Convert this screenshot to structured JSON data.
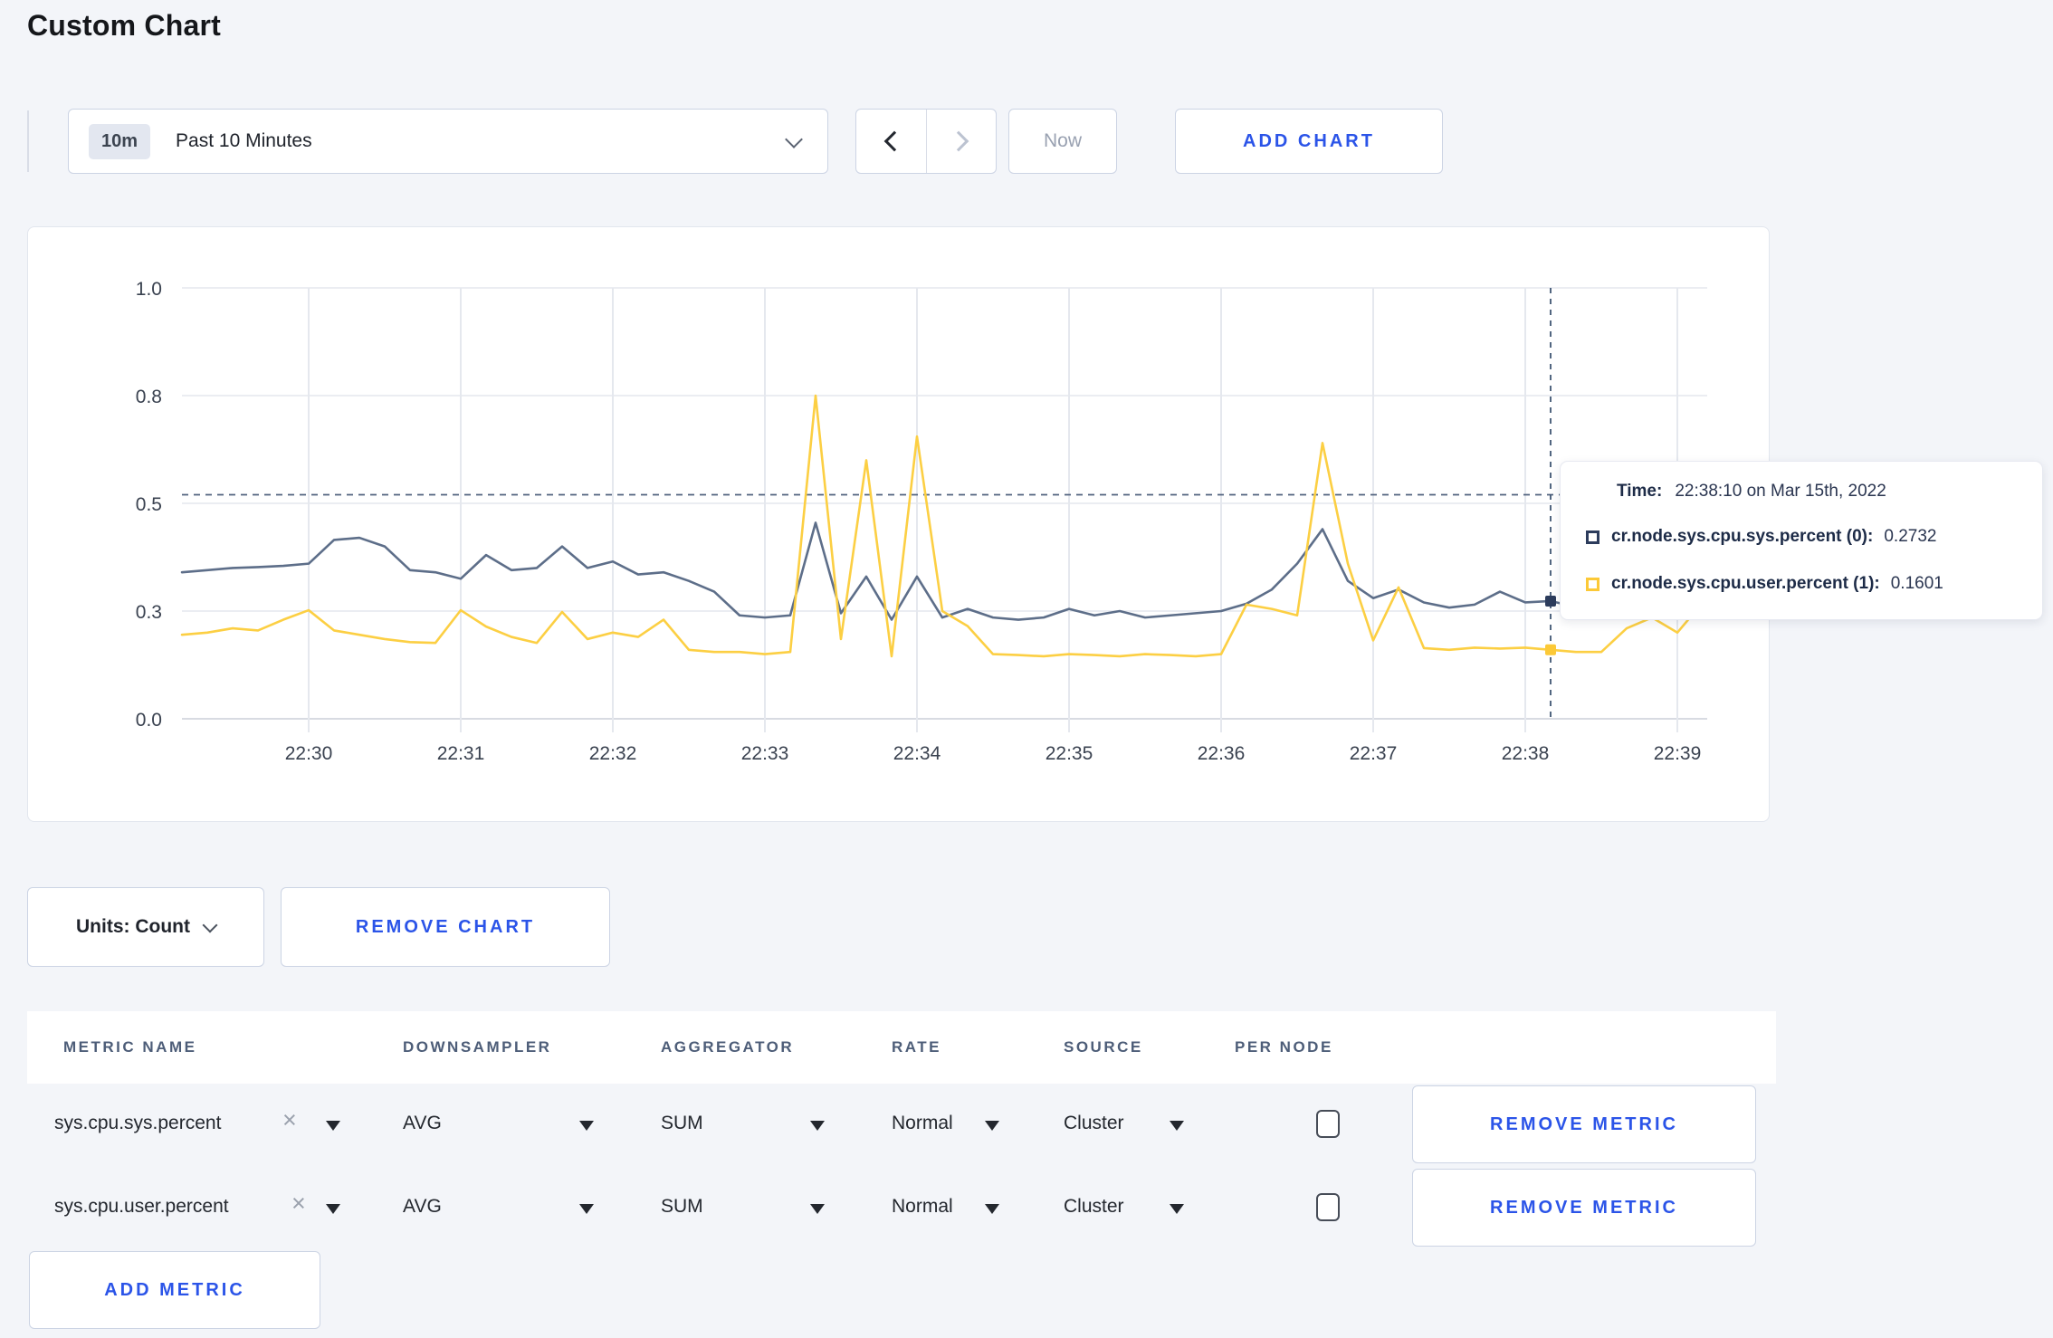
{
  "page": {
    "title": "Custom Chart",
    "background": "#f3f5f9",
    "accent_blue": "#2b54e8"
  },
  "toolbar": {
    "time_badge": "10m",
    "time_label": "Past 10 Minutes",
    "now_label": "Now",
    "add_chart_label": "ADD CHART"
  },
  "chart_data": {
    "type": "line",
    "title": "",
    "xlabel": "",
    "ylabel": "",
    "ylim": [
      0,
      1
    ],
    "grid": true,
    "legend_position": "none",
    "y_tick_values": [
      0,
      0.25,
      0.5,
      0.75,
      1.0
    ],
    "y_tick_labels": [
      "0.0",
      "0.3",
      "0.5",
      "0.8",
      "1.0"
    ],
    "x_tick_labels": [
      "22:30",
      "22:31",
      "22:32",
      "22:33",
      "22:34",
      "22:35",
      "22:36",
      "22:37",
      "22:38",
      "22:39"
    ],
    "x_start": "22:29:10",
    "x_end": "22:39:10",
    "interval_seconds": 10,
    "guide_line_value": 0.52,
    "crosshair_index": 54,
    "crosshair_time": "22:38:10",
    "series": [
      {
        "name": "cr.node.sys.cpu.sys.percent",
        "color": "#5d6e89",
        "marker_color": "#2c3c5c",
        "hover_value": 0.2732,
        "values": [
          0.34,
          0.345,
          0.35,
          0.352,
          0.355,
          0.36,
          0.415,
          0.42,
          0.4,
          0.345,
          0.34,
          0.325,
          0.38,
          0.345,
          0.35,
          0.4,
          0.35,
          0.365,
          0.335,
          0.34,
          0.32,
          0.295,
          0.24,
          0.235,
          0.24,
          0.455,
          0.245,
          0.33,
          0.23,
          0.33,
          0.235,
          0.255,
          0.235,
          0.23,
          0.235,
          0.255,
          0.24,
          0.25,
          0.235,
          0.24,
          0.245,
          0.25,
          0.267,
          0.3,
          0.36,
          0.44,
          0.32,
          0.28,
          0.3,
          0.27,
          0.258,
          0.265,
          0.295,
          0.27,
          0.2732,
          0.26,
          0.27,
          0.26,
          0.255,
          0.26,
          0.28
        ]
      },
      {
        "name": "cr.node.sys.cpu.user.percent",
        "color": "#fccf43",
        "marker_color": "#fcc937",
        "hover_value": 0.1601,
        "values": [
          0.195,
          0.2,
          0.21,
          0.205,
          0.23,
          0.252,
          0.205,
          0.195,
          0.185,
          0.178,
          0.176,
          0.252,
          0.214,
          0.19,
          0.176,
          0.248,
          0.185,
          0.2,
          0.19,
          0.23,
          0.16,
          0.155,
          0.155,
          0.15,
          0.155,
          0.75,
          0.185,
          0.6,
          0.145,
          0.655,
          0.25,
          0.215,
          0.15,
          0.148,
          0.145,
          0.15,
          0.148,
          0.145,
          0.15,
          0.148,
          0.145,
          0.15,
          0.265,
          0.255,
          0.24,
          0.64,
          0.36,
          0.182,
          0.305,
          0.164,
          0.16,
          0.165,
          0.163,
          0.165,
          0.1601,
          0.155,
          0.155,
          0.21,
          0.235,
          0.2,
          0.27
        ]
      }
    ]
  },
  "tooltip": {
    "time_label": "Time:",
    "time_value": "22:38:10 on Mar 15th, 2022",
    "rows": [
      {
        "label": "cr.node.sys.cpu.sys.percent (0):",
        "value": "0.2732",
        "color": "#2c3c5c"
      },
      {
        "label": "cr.node.sys.cpu.user.percent (1):",
        "value": "0.1601",
        "color": "#fcc937"
      }
    ]
  },
  "chart_controls": {
    "units_label": "Units: Count",
    "remove_chart_label": "REMOVE CHART"
  },
  "metrics_table": {
    "headers": [
      "METRIC NAME",
      "DOWNSAMPLER",
      "AGGREGATOR",
      "RATE",
      "SOURCE",
      "PER NODE"
    ],
    "remove_metric_label": "REMOVE METRIC",
    "add_metric_label": "ADD METRIC",
    "rows": [
      {
        "metric": "sys.cpu.sys.percent",
        "downsampler": "AVG",
        "aggregator": "SUM",
        "rate": "Normal",
        "source": "Cluster",
        "per_node_checked": false
      },
      {
        "metric": "sys.cpu.user.percent",
        "downsampler": "AVG",
        "aggregator": "SUM",
        "rate": "Normal",
        "source": "Cluster",
        "per_node_checked": false
      }
    ]
  }
}
